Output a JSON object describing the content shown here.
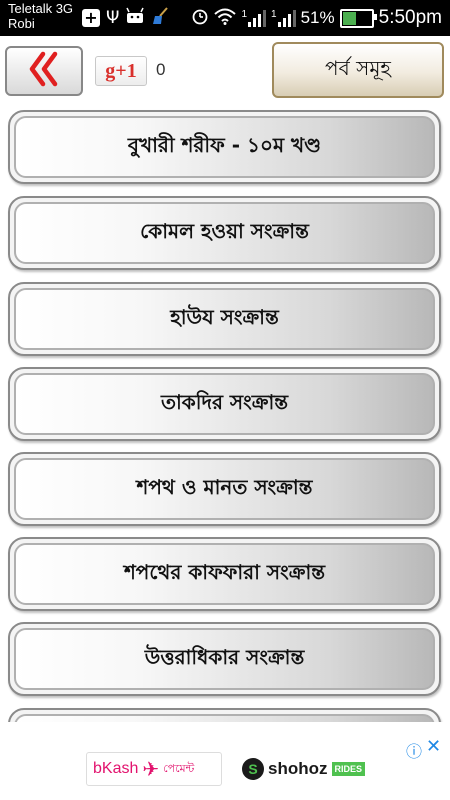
{
  "status_bar": {
    "carrier_line1": "Teletalk 3G",
    "carrier_line2": "Robi",
    "signal1_label": "1",
    "signal2_label": "1",
    "battery_percent": "51%",
    "battery_level": 0.51,
    "time": "5:50pm",
    "icons": [
      "plus-icon",
      "usb-icon",
      "android-icon",
      "broom-icon",
      "alarm-icon",
      "wifi-icon",
      "signal-icon",
      "signal-icon",
      "battery-charging-icon"
    ]
  },
  "header": {
    "back_icon": "double-chevron-left-icon",
    "gplus_label": "g+1",
    "gplus_count": "0",
    "parts_button": "পর্ব সমূহ"
  },
  "list": {
    "items": [
      {
        "label": "বুখারী শরীফ - ১০ম খণ্ড"
      },
      {
        "label": "কোমল হওয়া সংক্রান্ত"
      },
      {
        "label": "হাউয সংক্রান্ত"
      },
      {
        "label": "তাকদির সংক্রান্ত"
      },
      {
        "label": "শপথ ও মানত সংক্রান্ত"
      },
      {
        "label": "শপথের কাফফারা সংক্রান্ত"
      },
      {
        "label": "উত্তরাধিকার সংক্রান্ত"
      },
      {
        "label": ""
      }
    ]
  },
  "ad": {
    "info_icon": "info-icon",
    "close_icon": "close-icon",
    "bkash_name": "bKash",
    "bkash_sub": "পেমেন্ট",
    "shohoz_name": "shohoz",
    "shohoz_tag": "RIDES"
  },
  "colors": {
    "status_bar": "#000000",
    "gplus_red": "#d9302c",
    "back_red": "#e02020",
    "bkash_pink": "#e2136e",
    "shohoz_green": "#4fc14f",
    "ad_blue": "#1e88e5"
  }
}
